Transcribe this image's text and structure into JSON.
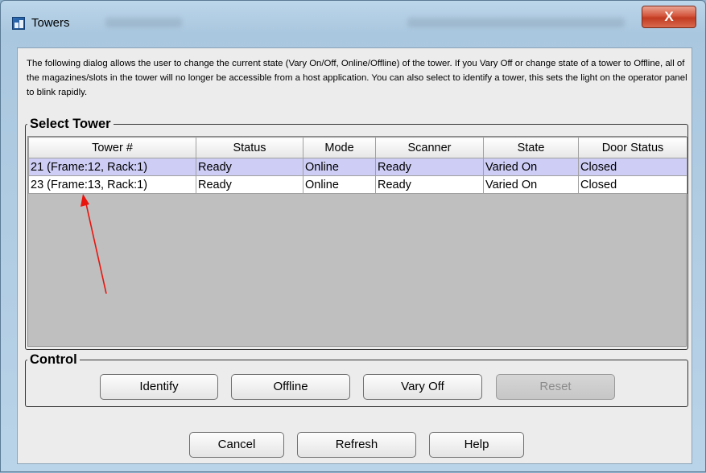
{
  "window": {
    "title": "Towers",
    "close_label": "X",
    "app_icon": "application-icon",
    "accent_close": "#c8452e"
  },
  "description": "The following dialog allows the user to change the current state (Vary On/Off, Online/Offline) of the tower. If you Vary Off or change state of a tower to Offline, all of the magazines/slots in the tower will no longer be accessible from a host application. You can also select to identify a tower, this sets the light on the operator panel to blink rapidly.",
  "select_tower": {
    "legend": "Select Tower",
    "columns": [
      "Tower #",
      "Status",
      "Mode",
      "Scanner",
      "State",
      "Door Status"
    ],
    "rows": [
      [
        "21 (Frame:12, Rack:1)",
        "Ready",
        "Online",
        "Ready",
        "Varied On",
        "Closed"
      ],
      [
        "23 (Frame:13, Rack:1)",
        "Ready",
        "Online",
        "Ready",
        "Varied On",
        "Closed"
      ]
    ],
    "selected_row_index": 0,
    "selected_row_color": "#cdcdf5"
  },
  "control": {
    "legend": "Control",
    "identify_label": "Identify",
    "offline_label": "Offline",
    "vary_off_label": "Vary Off",
    "reset_label": "Reset"
  },
  "footer": {
    "cancel_label": "Cancel",
    "refresh_label": "Refresh",
    "help_label": "Help"
  },
  "annotation": {
    "icon": "red-arrow",
    "color": "#e8140e"
  }
}
